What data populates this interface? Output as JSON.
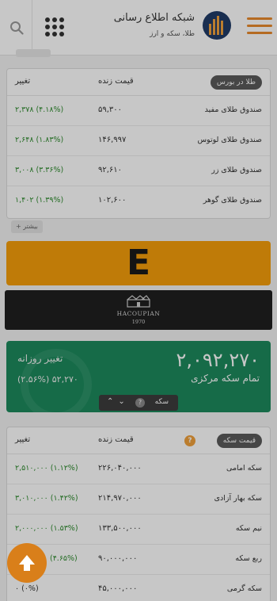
{
  "header": {
    "site_title": "شبکه اطلاع رسانی",
    "site_subtitle": "طلا، سکه و ارز",
    "icons": [
      "menu-icon",
      "logo-icon",
      "apps-grid-icon",
      "search-icon"
    ]
  },
  "gold_funds": {
    "badge": "طلا در بورس",
    "col_live": "قیمت زنده",
    "col_change": "تغییر",
    "rows": [
      {
        "name": "صندوق طلای مفید",
        "price": "۵۹,۳۰۰",
        "change": "۲,۳۷۸ (۴.۱۸%)"
      },
      {
        "name": "صندوق طلای لوتوس",
        "price": "۱۴۶,۹۹۷",
        "change": "۲,۶۴۸ (۱.۸۳%)"
      },
      {
        "name": "صندوق طلای زر",
        "price": "۹۲,۶۱۰",
        "change": "۳,۰۰۸ (۳.۳۶%)"
      },
      {
        "name": "صندوق طلای گوهر",
        "price": "۱۰۲,۶۰۰",
        "change": "۱,۴۰۲ (۱.۳۹%)"
      }
    ],
    "more_label": "بیشتر"
  },
  "ads": {
    "banner_letter": "E",
    "brand_name": "HACOUPIAN",
    "brand_year": "1970"
  },
  "coin_summary": {
    "price": "۲,۰۹۲,۲۷۰",
    "label": "تمام سکه مرکزی",
    "change_title": "تغییر روزانه",
    "change_value": "(۲.۵۶%) ۵۲,۲۷۰",
    "switch_label": "سکه",
    "help_glyph": "?"
  },
  "coins": {
    "badge": "قیمت سکه",
    "help_glyph": "?",
    "col_live": "قیمت زنده",
    "col_change": "تغییر",
    "rows": [
      {
        "name": "سکه امامی",
        "price": "۲۲۶,۰۴۰,۰۰۰",
        "change": "۲,۵۱۰,۰۰۰ (۱.۱۲%)"
      },
      {
        "name": "سکه بهار آزادی",
        "price": "۲۱۴,۹۷۰,۰۰۰",
        "change": "۳,۰۱۰,۰۰۰ (۱.۴۲%)"
      },
      {
        "name": "نیم سکه",
        "price": "۱۳۳,۵۰۰,۰۰۰",
        "change": "۲,۰۰۰,۰۰۰ (۱.۵۳%)"
      },
      {
        "name": "ربع سکه",
        "price": "۹۰,۰۰۰,۰۰۰",
        "change": "(۴.۶۵%)"
      },
      {
        "name": "سکه گرمی",
        "price": "۴۵,۰۰۰,۰۰۰",
        "change": "۰ (۰%)"
      }
    ]
  },
  "colors": {
    "accent": "#f0a03c",
    "green_panel": "#1d8a5d",
    "positive": "#2e8b2e",
    "ad_orange": "#f59e0b"
  }
}
